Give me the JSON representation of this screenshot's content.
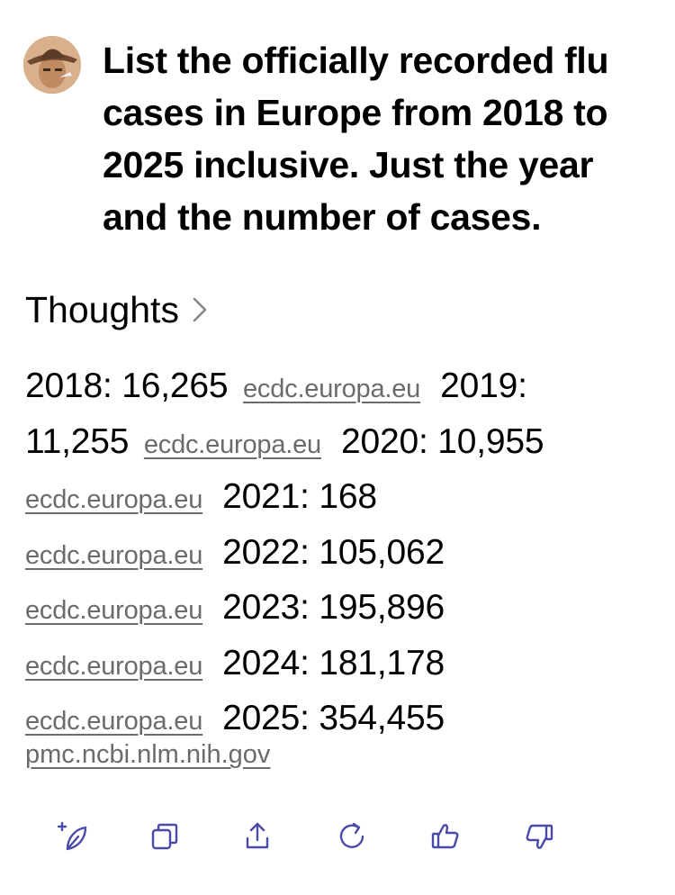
{
  "prompt": {
    "avatar_icon": "user-avatar",
    "lines": [
      "List the officially recorded flu",
      "cases in Europe from 2018 to",
      "2025 inclusive. Just the year",
      "and the number of cases."
    ]
  },
  "thoughts_label": "Thoughts",
  "results": [
    {
      "year": "2018",
      "cases": "16,265",
      "source": "ecdc.europa.eu"
    },
    {
      "year": "2019",
      "cases": "11,255",
      "source": "ecdc.europa.eu"
    },
    {
      "year": "2020",
      "cases": "10,955",
      "source": "ecdc.europa.eu"
    },
    {
      "year": "2021",
      "cases": "168",
      "source": "ecdc.europa.eu"
    },
    {
      "year": "2022",
      "cases": "105,062",
      "source": "ecdc.europa.eu"
    },
    {
      "year": "2023",
      "cases": "195,896",
      "source": "ecdc.europa.eu"
    },
    {
      "year": "2024",
      "cases": "181,178",
      "source": "ecdc.europa.eu"
    },
    {
      "year": "2025",
      "cases": "354,455",
      "source": "pmc.ncbi.nlm.nih.gov"
    }
  ],
  "actions": [
    {
      "name": "new-chat-sparkle-icon"
    },
    {
      "name": "copy-icon"
    },
    {
      "name": "share-icon"
    },
    {
      "name": "regenerate-icon"
    },
    {
      "name": "thumbs-up-icon"
    },
    {
      "name": "thumbs-down-icon"
    }
  ],
  "colors": {
    "accent": "#4a4aa8",
    "link": "#6b6b6b"
  }
}
